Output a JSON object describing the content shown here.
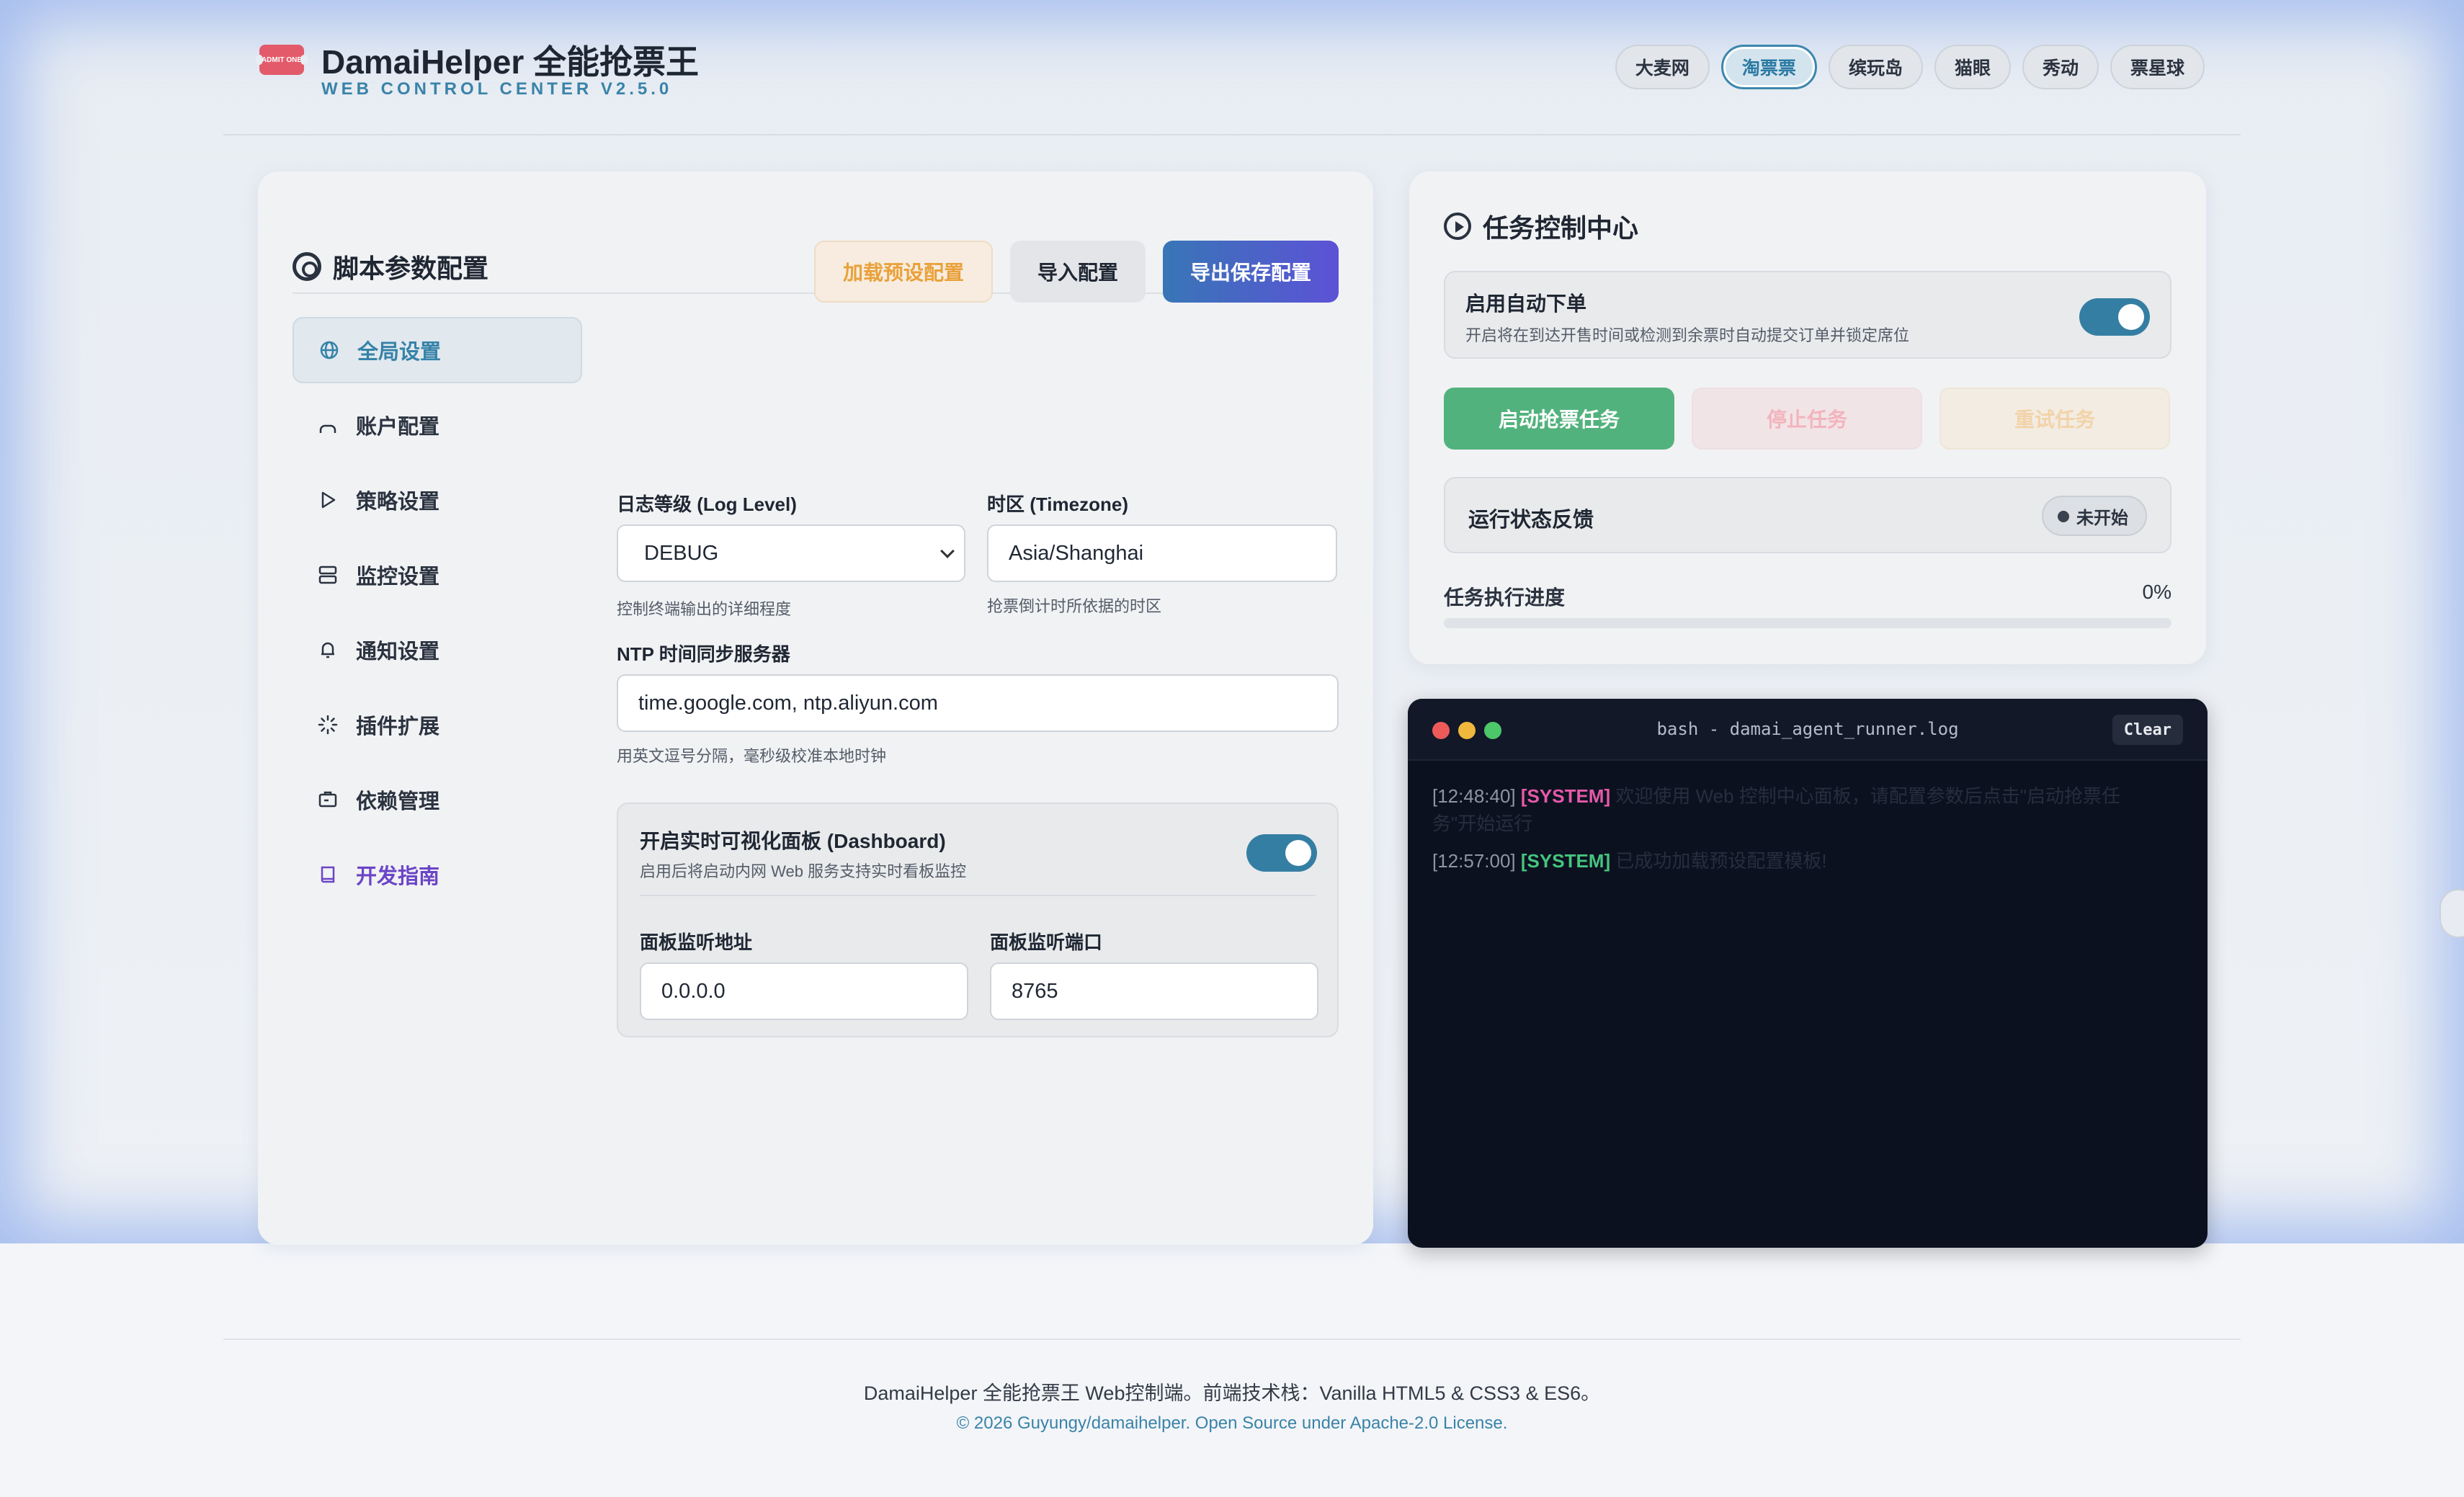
{
  "header": {
    "logo_text": "ADMIT ONE",
    "title": "DamaiHelper 全能抢票王",
    "subtitle": "WEB CONTROL CENTER V2.5.0",
    "platforms": [
      {
        "label": "大麦网",
        "active": false
      },
      {
        "label": "淘票票",
        "active": true
      },
      {
        "label": "缤玩岛",
        "active": false
      },
      {
        "label": "猫眼",
        "active": false
      },
      {
        "label": "秀动",
        "active": false
      },
      {
        "label": "票星球",
        "active": false
      }
    ]
  },
  "config": {
    "title": "脚本参数配置",
    "btn_preset": "加载预设配置",
    "btn_import": "导入配置",
    "btn_export": "导出保存配置",
    "sidebar": [
      {
        "label": "全局设置",
        "icon": "globe-icon",
        "active": true
      },
      {
        "label": "账户配置",
        "icon": "user-icon"
      },
      {
        "label": "策略设置",
        "icon": "play-icon"
      },
      {
        "label": "监控设置",
        "icon": "server-icon"
      },
      {
        "label": "通知设置",
        "icon": "bell-icon"
      },
      {
        "label": "插件扩展",
        "icon": "loader-icon"
      },
      {
        "label": "依赖管理",
        "icon": "package-icon"
      },
      {
        "label": "开发指南",
        "icon": "book-icon"
      }
    ],
    "log_level": {
      "label": "日志等级 (Log Level)",
      "value": "DEBUG",
      "hint": "控制终端输出的详细程度"
    },
    "timezone": {
      "label": "时区 (Timezone)",
      "value": "Asia/Shanghai",
      "hint": "抢票倒计时所依据的时区"
    },
    "ntp": {
      "label": "NTP 时间同步服务器",
      "value": "time.google.com, ntp.aliyun.com",
      "hint": "用英文逗号分隔，毫秒级校准本地时钟"
    },
    "dashboard": {
      "title": "开启实时可视化面板 (Dashboard)",
      "desc": "启用后将启动内网 Web 服务支持实时看板监控",
      "enabled": true,
      "addr_label": "面板监听地址",
      "addr_value": "0.0.0.0",
      "port_label": "面板监听端口",
      "port_value": "8765"
    }
  },
  "control": {
    "title": "任务控制中心",
    "auto_title": "启用自动下单",
    "auto_desc": "开启将在到达开售时间或检测到余票时自动提交订单并锁定席位",
    "auto_enabled": true,
    "btn_start": "启动抢票任务",
    "btn_stop": "停止任务",
    "btn_retry": "重试任务",
    "status_label": "运行状态反馈",
    "status_value": "未开始",
    "progress_label": "任务执行进度",
    "progress_text": "0%",
    "progress_value": 0
  },
  "terminal": {
    "title": "bash - damai_agent_runner.log",
    "clear": "Clear",
    "logs": [
      {
        "ts": "[12:48:40]",
        "tag": "[SYSTEM]",
        "tag_color": "pink",
        "msg": "欢迎使用 Web 控制中心面板，请配置参数后点击\"启动抢票任务\"开始运行"
      },
      {
        "ts": "[12:57:00]",
        "tag": "[SYSTEM]",
        "tag_color": "green",
        "msg": "已成功加载预设配置模板!"
      }
    ]
  },
  "footer": {
    "line1": "DamaiHelper 全能抢票王 Web控制端。前端技术栈：Vanilla HTML5 & CSS3 & ES6。",
    "line2": "© 2026 Guyungy/damaihelper. Open Source under Apache-2.0 License."
  }
}
